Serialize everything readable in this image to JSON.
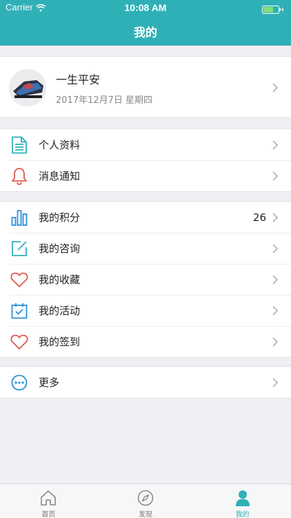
{
  "status": {
    "carrier": "Carrier",
    "time": "10:08 AM"
  },
  "nav": {
    "title": "我的"
  },
  "profile": {
    "name": "一生平安",
    "date": "2017年12月7日 星期四"
  },
  "menu1": [
    {
      "label": "个人资料",
      "icon": "document-icon"
    },
    {
      "label": "消息通知",
      "icon": "bell-icon"
    }
  ],
  "menu2": [
    {
      "label": "我的积分",
      "icon": "bar-chart-icon",
      "value": "26"
    },
    {
      "label": "我的咨询",
      "icon": "edit-icon"
    },
    {
      "label": "我的收藏",
      "icon": "heart-icon"
    },
    {
      "label": "我的活动",
      "icon": "calendar-check-icon"
    },
    {
      "label": "我的签到",
      "icon": "heart-icon"
    }
  ],
  "menu3": [
    {
      "label": "更多",
      "icon": "more-icon"
    }
  ],
  "tabs": [
    {
      "label": "首页",
      "icon": "home-icon"
    },
    {
      "label": "发现",
      "icon": "compass-icon"
    },
    {
      "label": "我的",
      "icon": "person-icon"
    }
  ],
  "colors": {
    "accent": "#2fb0b7",
    "blue": "#2a8fd6",
    "red": "#e0584e"
  }
}
